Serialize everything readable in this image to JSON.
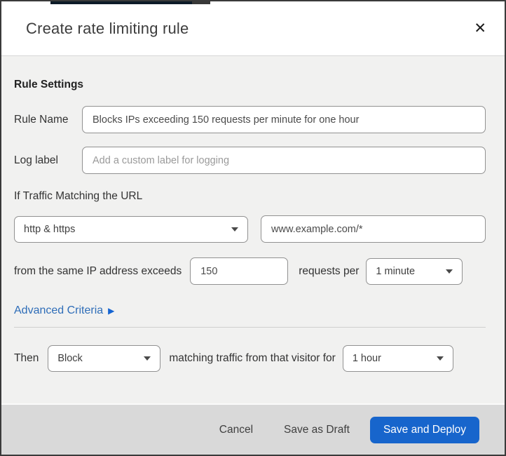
{
  "dialog": {
    "title": "Create rate limiting rule",
    "close_icon": "✕"
  },
  "rule_settings": {
    "heading": "Rule Settings",
    "rule_name": {
      "label": "Rule Name",
      "value": "Blocks IPs exceeding 150 requests per minute for one hour"
    },
    "log_label": {
      "label": "Log label",
      "placeholder": "Add a custom label for logging"
    }
  },
  "traffic_match": {
    "heading": "If Traffic Matching the URL",
    "scheme_select": {
      "value": "http & https"
    },
    "url_input": {
      "value": "www.example.com/*"
    },
    "threshold": {
      "prefix": "from the same IP address exceeds",
      "requests_value": "150",
      "middle": "requests per",
      "period_select": {
        "value": "1 minute"
      }
    },
    "advanced_link": {
      "label": "Advanced Criteria",
      "arrow_icon": "▶"
    }
  },
  "action": {
    "prefix": "Then",
    "action_select": {
      "value": "Block"
    },
    "middle": "matching traffic from that visitor for",
    "duration_select": {
      "value": "1 hour"
    }
  },
  "footer": {
    "cancel_label": "Cancel",
    "save_draft_label": "Save as Draft",
    "save_deploy_label": "Save and Deploy"
  },
  "colors": {
    "primary_button": "#1765cc",
    "link": "#2e6db8",
    "top_accent": "#0d1b28",
    "body_background": "#f1f1f0",
    "footer_background": "#d9d9d9"
  }
}
